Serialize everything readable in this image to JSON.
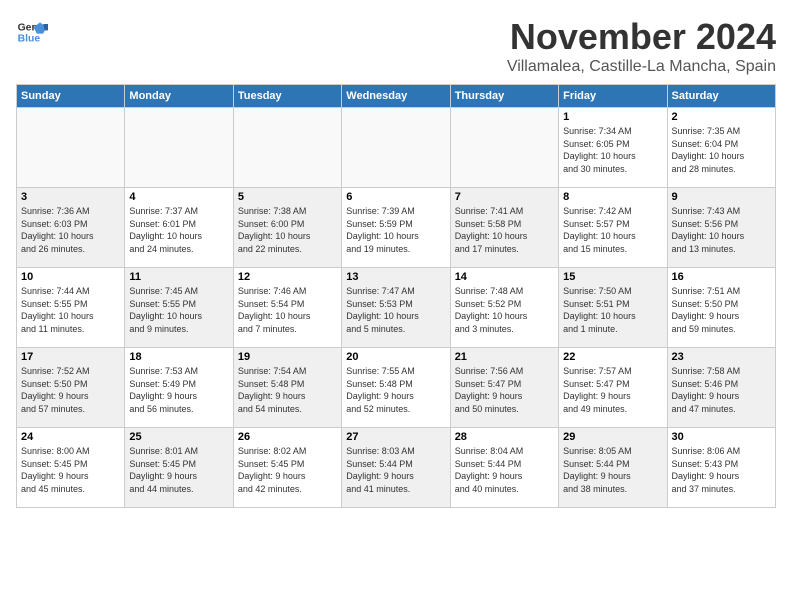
{
  "header": {
    "logo_line1": "General",
    "logo_line2": "Blue",
    "month": "November 2024",
    "location": "Villamalea, Castille-La Mancha, Spain"
  },
  "weekdays": [
    "Sunday",
    "Monday",
    "Tuesday",
    "Wednesday",
    "Thursday",
    "Friday",
    "Saturday"
  ],
  "weeks": [
    [
      {
        "day": "",
        "info": "",
        "empty": true
      },
      {
        "day": "",
        "info": "",
        "empty": true
      },
      {
        "day": "",
        "info": "",
        "empty": true
      },
      {
        "day": "",
        "info": "",
        "empty": true
      },
      {
        "day": "",
        "info": "",
        "empty": true
      },
      {
        "day": "1",
        "info": "Sunrise: 7:34 AM\nSunset: 6:05 PM\nDaylight: 10 hours\nand 30 minutes.",
        "empty": false
      },
      {
        "day": "2",
        "info": "Sunrise: 7:35 AM\nSunset: 6:04 PM\nDaylight: 10 hours\nand 28 minutes.",
        "empty": false
      }
    ],
    [
      {
        "day": "3",
        "info": "Sunrise: 7:36 AM\nSunset: 6:03 PM\nDaylight: 10 hours\nand 26 minutes.",
        "shaded": true
      },
      {
        "day": "4",
        "info": "Sunrise: 7:37 AM\nSunset: 6:01 PM\nDaylight: 10 hours\nand 24 minutes.",
        "shaded": false
      },
      {
        "day": "5",
        "info": "Sunrise: 7:38 AM\nSunset: 6:00 PM\nDaylight: 10 hours\nand 22 minutes.",
        "shaded": true
      },
      {
        "day": "6",
        "info": "Sunrise: 7:39 AM\nSunset: 5:59 PM\nDaylight: 10 hours\nand 19 minutes.",
        "shaded": false
      },
      {
        "day": "7",
        "info": "Sunrise: 7:41 AM\nSunset: 5:58 PM\nDaylight: 10 hours\nand 17 minutes.",
        "shaded": true
      },
      {
        "day": "8",
        "info": "Sunrise: 7:42 AM\nSunset: 5:57 PM\nDaylight: 10 hours\nand 15 minutes.",
        "shaded": false
      },
      {
        "day": "9",
        "info": "Sunrise: 7:43 AM\nSunset: 5:56 PM\nDaylight: 10 hours\nand 13 minutes.",
        "shaded": true
      }
    ],
    [
      {
        "day": "10",
        "info": "Sunrise: 7:44 AM\nSunset: 5:55 PM\nDaylight: 10 hours\nand 11 minutes.",
        "shaded": false
      },
      {
        "day": "11",
        "info": "Sunrise: 7:45 AM\nSunset: 5:55 PM\nDaylight: 10 hours\nand 9 minutes.",
        "shaded": true
      },
      {
        "day": "12",
        "info": "Sunrise: 7:46 AM\nSunset: 5:54 PM\nDaylight: 10 hours\nand 7 minutes.",
        "shaded": false
      },
      {
        "day": "13",
        "info": "Sunrise: 7:47 AM\nSunset: 5:53 PM\nDaylight: 10 hours\nand 5 minutes.",
        "shaded": true
      },
      {
        "day": "14",
        "info": "Sunrise: 7:48 AM\nSunset: 5:52 PM\nDaylight: 10 hours\nand 3 minutes.",
        "shaded": false
      },
      {
        "day": "15",
        "info": "Sunrise: 7:50 AM\nSunset: 5:51 PM\nDaylight: 10 hours\nand 1 minute.",
        "shaded": true
      },
      {
        "day": "16",
        "info": "Sunrise: 7:51 AM\nSunset: 5:50 PM\nDaylight: 9 hours\nand 59 minutes.",
        "shaded": false
      }
    ],
    [
      {
        "day": "17",
        "info": "Sunrise: 7:52 AM\nSunset: 5:50 PM\nDaylight: 9 hours\nand 57 minutes.",
        "shaded": true
      },
      {
        "day": "18",
        "info": "Sunrise: 7:53 AM\nSunset: 5:49 PM\nDaylight: 9 hours\nand 56 minutes.",
        "shaded": false
      },
      {
        "day": "19",
        "info": "Sunrise: 7:54 AM\nSunset: 5:48 PM\nDaylight: 9 hours\nand 54 minutes.",
        "shaded": true
      },
      {
        "day": "20",
        "info": "Sunrise: 7:55 AM\nSunset: 5:48 PM\nDaylight: 9 hours\nand 52 minutes.",
        "shaded": false
      },
      {
        "day": "21",
        "info": "Sunrise: 7:56 AM\nSunset: 5:47 PM\nDaylight: 9 hours\nand 50 minutes.",
        "shaded": true
      },
      {
        "day": "22",
        "info": "Sunrise: 7:57 AM\nSunset: 5:47 PM\nDaylight: 9 hours\nand 49 minutes.",
        "shaded": false
      },
      {
        "day": "23",
        "info": "Sunrise: 7:58 AM\nSunset: 5:46 PM\nDaylight: 9 hours\nand 47 minutes.",
        "shaded": true
      }
    ],
    [
      {
        "day": "24",
        "info": "Sunrise: 8:00 AM\nSunset: 5:45 PM\nDaylight: 9 hours\nand 45 minutes.",
        "shaded": false
      },
      {
        "day": "25",
        "info": "Sunrise: 8:01 AM\nSunset: 5:45 PM\nDaylight: 9 hours\nand 44 minutes.",
        "shaded": true
      },
      {
        "day": "26",
        "info": "Sunrise: 8:02 AM\nSunset: 5:45 PM\nDaylight: 9 hours\nand 42 minutes.",
        "shaded": false
      },
      {
        "day": "27",
        "info": "Sunrise: 8:03 AM\nSunset: 5:44 PM\nDaylight: 9 hours\nand 41 minutes.",
        "shaded": true
      },
      {
        "day": "28",
        "info": "Sunrise: 8:04 AM\nSunset: 5:44 PM\nDaylight: 9 hours\nand 40 minutes.",
        "shaded": false
      },
      {
        "day": "29",
        "info": "Sunrise: 8:05 AM\nSunset: 5:44 PM\nDaylight: 9 hours\nand 38 minutes.",
        "shaded": true
      },
      {
        "day": "30",
        "info": "Sunrise: 8:06 AM\nSunset: 5:43 PM\nDaylight: 9 hours\nand 37 minutes.",
        "shaded": false
      }
    ]
  ]
}
